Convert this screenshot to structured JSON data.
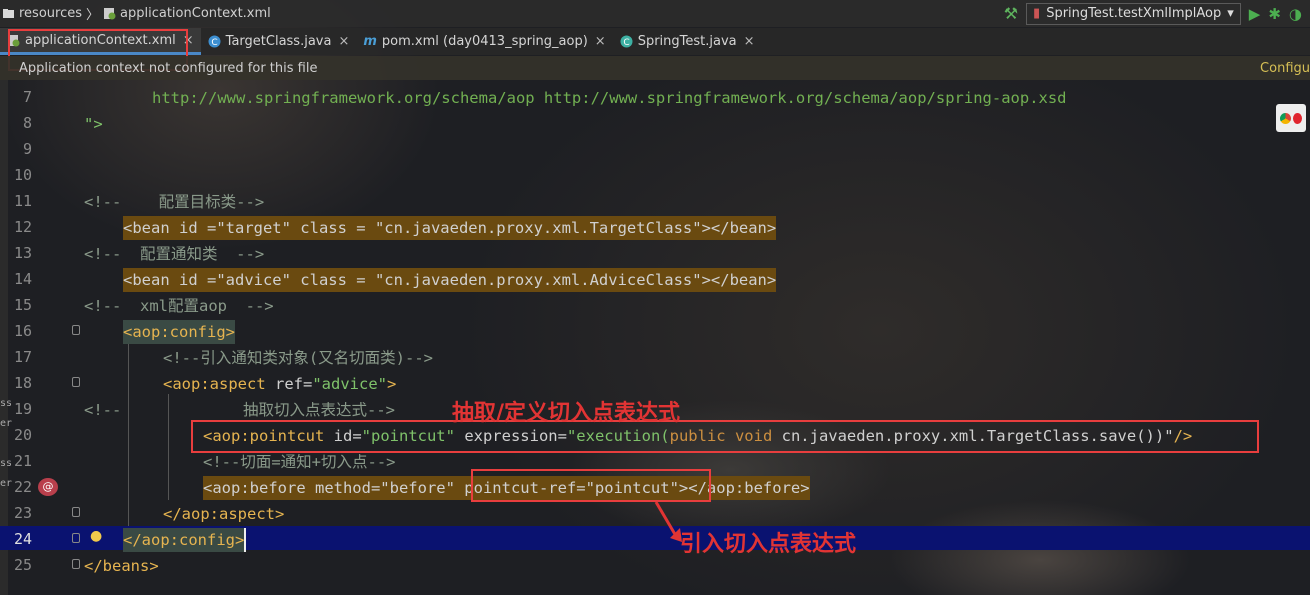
{
  "breadcrumb": {
    "folder": "resources",
    "file": "applicationContext.xml"
  },
  "run_config": {
    "label": "SpringTest.testXmlImplAop"
  },
  "tabs": [
    {
      "label": "applicationContext.xml",
      "active": true,
      "icon": "spring-xml-icon"
    },
    {
      "label": "TargetClass.java",
      "active": false,
      "icon": "class-icon"
    },
    {
      "label": "pom.xml (day0413_spring_aop)",
      "active": false,
      "icon": "maven-icon"
    },
    {
      "label": "SpringTest.java",
      "active": false,
      "icon": "test-class-icon"
    }
  ],
  "notice": {
    "message": "Application context not configured for this file",
    "action": "Configu"
  },
  "lines": [
    {
      "n": "7"
    },
    {
      "n": "8"
    },
    {
      "n": "9"
    },
    {
      "n": "10"
    },
    {
      "n": "11"
    },
    {
      "n": "12"
    },
    {
      "n": "13"
    },
    {
      "n": "14"
    },
    {
      "n": "15"
    },
    {
      "n": "16"
    },
    {
      "n": "17"
    },
    {
      "n": "18"
    },
    {
      "n": "19"
    },
    {
      "n": "20"
    },
    {
      "n": "21"
    },
    {
      "n": "22"
    },
    {
      "n": "23"
    },
    {
      "n": "24"
    },
    {
      "n": "25"
    }
  ],
  "code": {
    "l7": "http://www.springframework.org/schema/aop http://www.springframework.org/schema/aop/spring-aop.xsd",
    "l8": "\">",
    "l11": "<!--    配置目标类-->",
    "l12": "<bean id =\"target\" class = \"cn.javaeden.proxy.xml.TargetClass\"></bean>",
    "l13": "<!--  配置通知类  -->",
    "l14": "<bean id =\"advice\" class = \"cn.javaeden.proxy.xml.AdviceClass\"></bean>",
    "l15": "<!--  xml配置aop  -->",
    "l16": "<aop:config>",
    "l17": "<!--引入通知类对象(又名切面类)-->",
    "l18_tag": "<aop:aspect",
    "l18_attr": " ref=",
    "l18_val": "\"advice\"",
    "l18_end": ">",
    "l19a": "<!--",
    "l19b": "抽取切入点表达式-->",
    "l20_tag": "<aop:pointcut",
    "l20_attr1": " id=",
    "l20_val1": "\"pointcut\"",
    "l20_attr2": " expression=",
    "l20_val2a": "\"execution(",
    "l20_kw": "public void",
    "l20_val2b": " cn.javaeden.proxy.xml.TargetClass.save())\"",
    "l20_end": "/>",
    "l21": "<!--切面=通知+切入点-->",
    "l22": "<aop:before method=\"before\" pointcut-ref=\"pointcut\"></aop:before>",
    "l23": "</aop:aspect>",
    "l24": "</aop:config>",
    "l25": "</beans>"
  },
  "annotations": {
    "pointcut_define": "抽取/定义切入点表达式",
    "pointcut_ref": "引入切入点表达式"
  },
  "left_edge_text": [
    "ss",
    "er",
    "ss",
    "er"
  ]
}
